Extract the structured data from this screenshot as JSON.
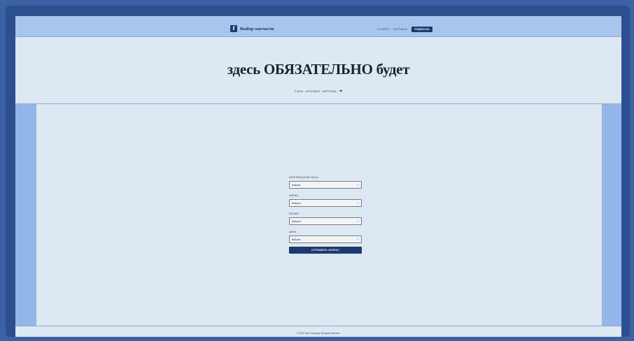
{
  "navbar": {
    "brand_icon": "f",
    "brand_text": "Выбор магчасти",
    "links": [
      "О САЙТЕ",
      "КОНТАКТЫ"
    ],
    "cta_label": "ПОДПИСКА"
  },
  "hero": {
    "title": "здесь ОБЯЗАТЕЛЬНО будет",
    "subtitle": "ОЧЕНЬ...КРАСИВАЯ...КАРТИНКА...",
    "heart": "❤"
  },
  "form": {
    "fields": [
      {
        "label": "МАТЕРИАЛЬНАЯ ЧАСТЬ",
        "value": "Выбрать"
      },
      {
        "label": "ФИРМА",
        "value": "Выбрать"
      },
      {
        "label": "РАЗМЕР",
        "value": "Выбрать"
      },
      {
        "label": "ЦЕНА",
        "value": "Выбрать"
      }
    ],
    "chevron": "⌄",
    "submit_label": "ОТПРАВИТЬ ЗАПРОС"
  },
  "footer": {
    "text": "© 2022 Your Company, All rights reserved."
  },
  "colors": {
    "accent": "#1d3a70",
    "navbar": "#aac5ec",
    "side": "#92b6ea",
    "page": "#dde9f2",
    "heart": "#b31a2c"
  }
}
